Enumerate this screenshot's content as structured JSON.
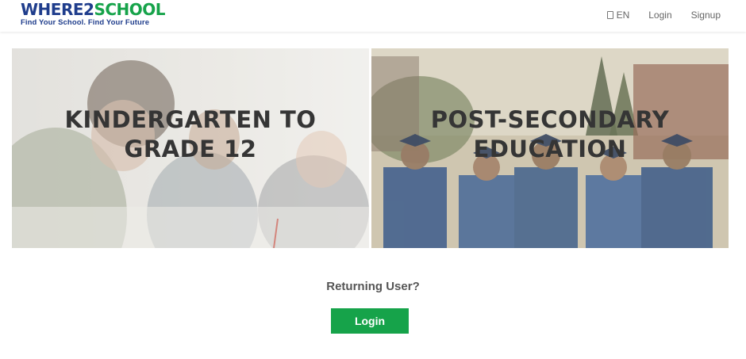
{
  "header": {
    "logo": {
      "where": "WHERE",
      "two": "2",
      "school": "SCHOOL",
      "tagline": "Find Your School.  Find Your Future"
    },
    "nav": {
      "language_icon": "globe-icon",
      "language": "EN",
      "login": "Login",
      "signup": "Signup"
    }
  },
  "panels": [
    {
      "title": "KINDERGARTEN TO GRADE 12"
    },
    {
      "title": "POST-SECONDARY EDUCATION"
    }
  ],
  "returning": {
    "prompt": "Returning User?",
    "login_button": "Login"
  },
  "colors": {
    "brand_blue": "#1f3d8c",
    "brand_green": "#16a34a"
  }
}
